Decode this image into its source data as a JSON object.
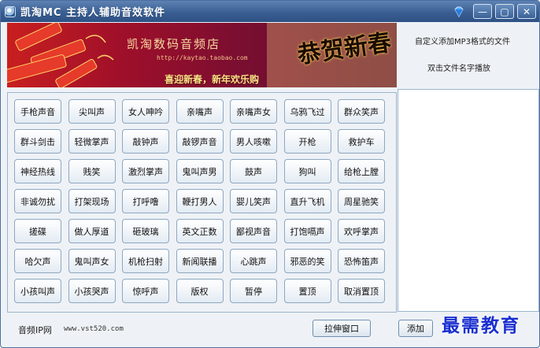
{
  "window": {
    "title": "凯淘MC 主持人辅助音效软件",
    "icons": {
      "app": "app-icon",
      "skin": "diamond-skin-icon"
    },
    "controls": {
      "minimize": "—",
      "maximize": "▢",
      "close": "✕"
    }
  },
  "banner": {
    "shop_name": "凯淘数码音频店",
    "shop_url": "http://kaytao.taobao.com",
    "greeting": "喜迎新春，新年欢乐购",
    "calligraphy": "恭贺新春"
  },
  "sounds": [
    "手枪声音",
    "尖叫声",
    "女人呻吟",
    "亲嘴声",
    "亲嘴声女",
    "乌鸦飞过",
    "群众笑声",
    "群斗剑击",
    "轻微掌声",
    "敲钟声",
    "敲锣声音",
    "男人咳嗽",
    "开枪",
    "救护车",
    "神经热线",
    "贱笑",
    "激烈掌声",
    "鬼叫声男",
    "鼓声",
    "狗叫",
    "给枪上膛",
    "非诚勿扰",
    "打架现场",
    "打呼噜",
    "鞭打男人",
    "婴儿笑声",
    "直升飞机",
    "周星驰笑",
    "搓碟",
    "做人厚道",
    "砸玻璃",
    "英文正数",
    "鄙视声音",
    "打饱嗝声",
    "欢呼掌声",
    "哈欠声",
    "鬼叫声女",
    "机枪扫射",
    "新闻联播",
    "心跳声",
    "邪恶的笑",
    "恐怖笛声",
    "小孩叫声",
    "小孩哭声",
    "惊呼声",
    "版权",
    "暂停",
    "置顶",
    "取消置顶"
  ],
  "info": {
    "line1": "自定义添加MP3格式的文件",
    "line2": "双击文件名字播放"
  },
  "footer": {
    "label": "音频IP网",
    "url": "www.vst520.com",
    "stretch_button": "拉伸窗口",
    "add_button": "添加"
  },
  "watermark": "最需教育"
}
